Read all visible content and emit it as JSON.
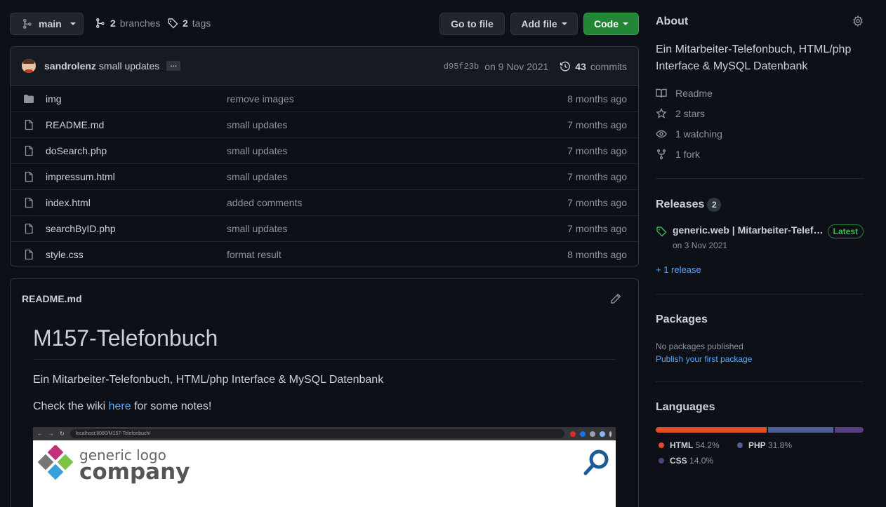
{
  "toolbar": {
    "branch": "main",
    "branches_count": "2",
    "branches_label": "branches",
    "tags_count": "2",
    "tags_label": "tags",
    "go_to_file": "Go to file",
    "add_file": "Add file",
    "code": "Code",
    "code_color": "#238636"
  },
  "commit": {
    "author": "sandrolenz",
    "message": "small updates",
    "ellipsis": "…",
    "sha": "d95f23b",
    "date": "on 9 Nov 2021",
    "count": "43",
    "count_label": "commits"
  },
  "files": [
    {
      "icon": "folder-icon",
      "name": "img",
      "commit": "remove images",
      "age": "8 months ago"
    },
    {
      "icon": "file-icon",
      "name": "README.md",
      "commit": "small updates",
      "age": "7 months ago"
    },
    {
      "icon": "file-icon",
      "name": "doSearch.php",
      "commit": "small updates",
      "age": "7 months ago"
    },
    {
      "icon": "file-icon",
      "name": "impressum.html",
      "commit": "small updates",
      "age": "7 months ago"
    },
    {
      "icon": "file-icon",
      "name": "index.html",
      "commit": "added comments",
      "age": "7 months ago"
    },
    {
      "icon": "file-icon",
      "name": "searchByID.php",
      "commit": "small updates",
      "age": "7 months ago"
    },
    {
      "icon": "file-icon",
      "name": "style.css",
      "commit": "format result",
      "age": "8 months ago"
    }
  ],
  "readme": {
    "filename": "README.md",
    "h1": "M157-Telefonbuch",
    "p1": "Ein Mitarbeiter-Telefonbuch, HTML/php Interface & MySQL Datenbank",
    "p2_before": "Check the wiki ",
    "p2_link": "here",
    "p2_after": " for some notes!",
    "screenshot": {
      "url": "localhost:8080/M157-Telefonbuch/",
      "logo_line1": "generic logo",
      "logo_line2": "company"
    }
  },
  "about": {
    "title": "About",
    "description": "Ein Mitarbeiter-Telefonbuch, HTML/php Interface & MySQL Datenbank",
    "readme": "Readme",
    "stars": "2 stars",
    "watching": "1 watching",
    "forks": "1 fork"
  },
  "releases": {
    "title": "Releases",
    "count": "2",
    "name": "generic.web | Mitarbeiter-Telefonbuch",
    "latest": "Latest",
    "date": "on 3 Nov 2021",
    "more": "+ 1 release"
  },
  "packages": {
    "title": "Packages",
    "none": "No packages published",
    "publish": "Publish your first package"
  },
  "languages": {
    "title": "Languages",
    "items": [
      {
        "name": "HTML",
        "percent": "54.2%",
        "value": 54.2,
        "color": "#e34c26"
      },
      {
        "name": "PHP",
        "percent": "31.8%",
        "value": 31.8,
        "color": "#4F5D95"
      },
      {
        "name": "CSS",
        "percent": "14.0%",
        "value": 14.0,
        "color": "#563d7c"
      }
    ]
  }
}
